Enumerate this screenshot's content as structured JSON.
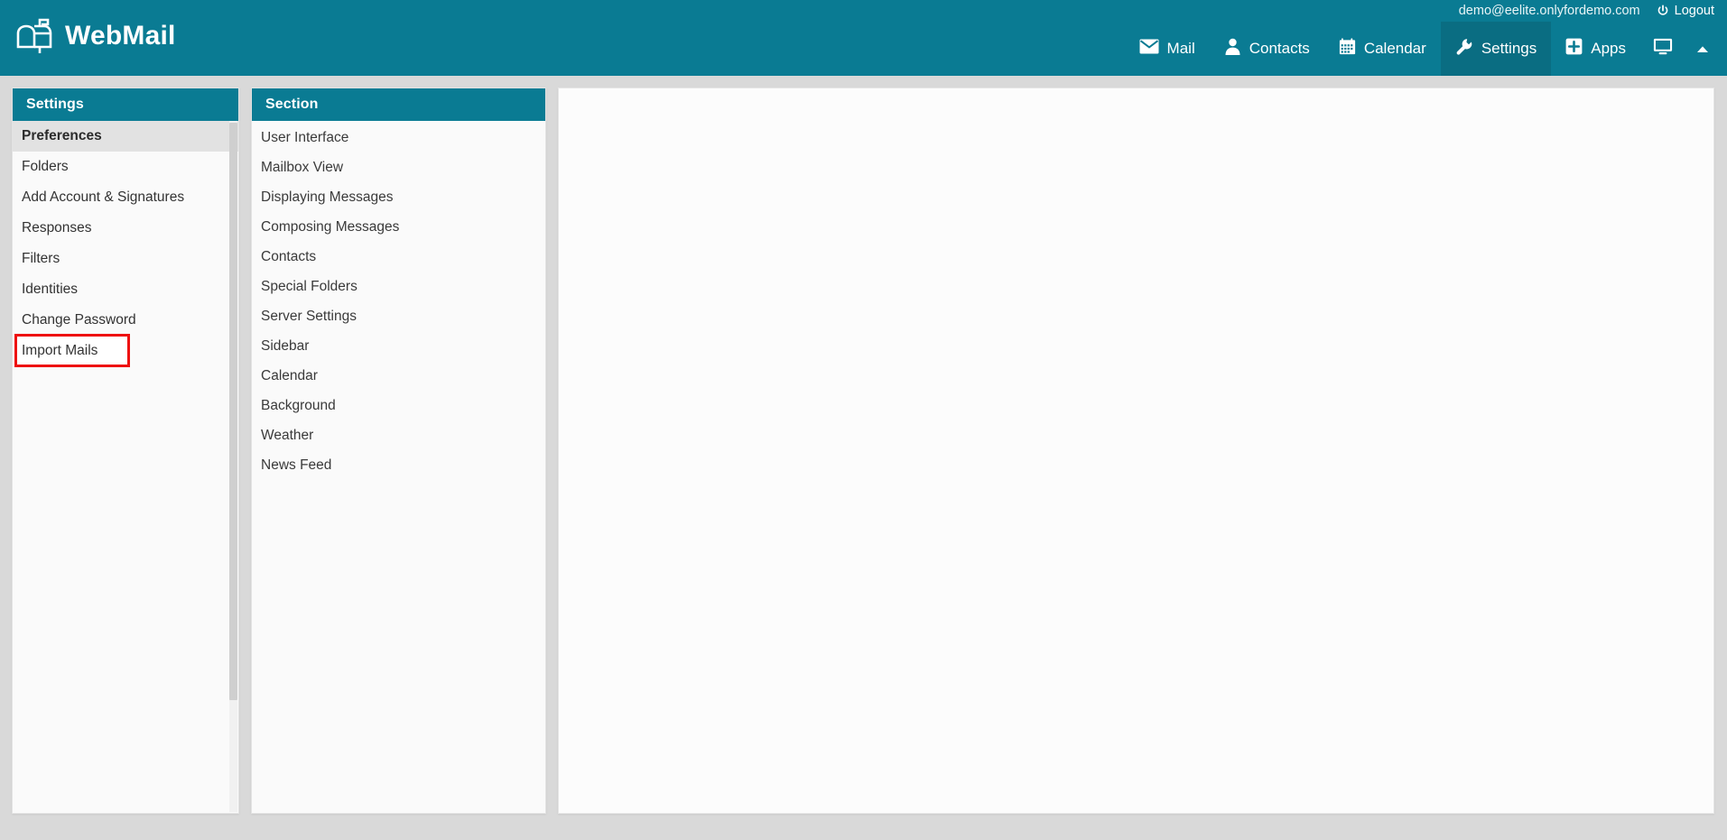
{
  "app": {
    "brand_name": "WebMail",
    "brand_logo_icon": "mailbox-icon",
    "accent_color": "#0a7b93",
    "accent_active_color": "#0a6d82",
    "highlight_color": "#ee1111"
  },
  "header": {
    "account_email": "demo@eelite.onlyfordemo.com",
    "logout_label": "Logout",
    "logout_icon": "power-icon",
    "nav": [
      {
        "label": "Mail",
        "icon": "envelope-icon",
        "active": false
      },
      {
        "label": "Contacts",
        "icon": "person-icon",
        "active": false
      },
      {
        "label": "Calendar",
        "icon": "calendar-icon",
        "active": false
      },
      {
        "label": "Settings",
        "icon": "wrench-icon",
        "active": true
      },
      {
        "label": "Apps",
        "icon": "plus-square-icon",
        "active": false
      }
    ],
    "desktop_icon": "monitor-icon",
    "collapse_icon": "chevron-up-icon"
  },
  "settings_panel": {
    "title": "Settings",
    "items": [
      {
        "label": "Preferences",
        "selected": true,
        "highlighted": false
      },
      {
        "label": "Folders",
        "selected": false,
        "highlighted": false
      },
      {
        "label": "Add Account & Signatures",
        "selected": false,
        "highlighted": false
      },
      {
        "label": "Responses",
        "selected": false,
        "highlighted": false
      },
      {
        "label": "Filters",
        "selected": false,
        "highlighted": false
      },
      {
        "label": "Identities",
        "selected": false,
        "highlighted": false
      },
      {
        "label": "Change Password",
        "selected": false,
        "highlighted": false
      },
      {
        "label": "Import Mails",
        "selected": false,
        "highlighted": true
      }
    ]
  },
  "section_panel": {
    "title": "Section",
    "items": [
      {
        "label": "User Interface"
      },
      {
        "label": "Mailbox View"
      },
      {
        "label": "Displaying Messages"
      },
      {
        "label": "Composing Messages"
      },
      {
        "label": "Contacts"
      },
      {
        "label": "Special Folders"
      },
      {
        "label": "Server Settings"
      },
      {
        "label": "Sidebar"
      },
      {
        "label": "Calendar"
      },
      {
        "label": "Background"
      },
      {
        "label": "Weather"
      },
      {
        "label": "News Feed"
      }
    ]
  },
  "content_panel": {
    "body_text": ""
  }
}
